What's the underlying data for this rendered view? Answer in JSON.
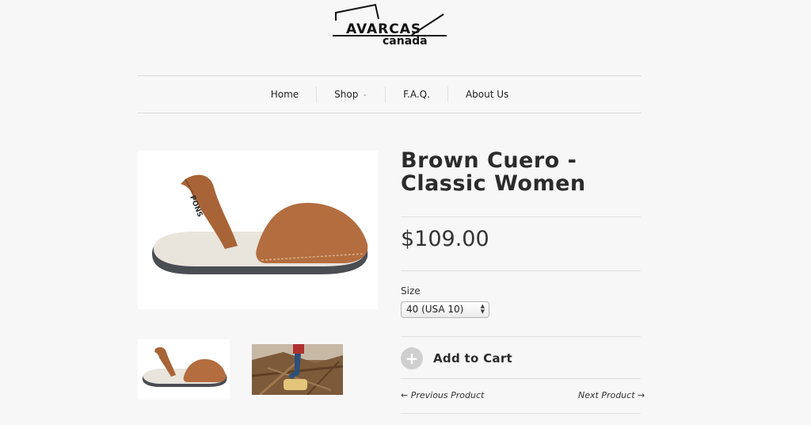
{
  "brand": {
    "logo_main": "AVARCAS",
    "logo_sub": "canada",
    "strap_print": "PONS"
  },
  "nav": {
    "items": [
      {
        "label": "Home"
      },
      {
        "label": "Shop",
        "has_dropdown": true
      },
      {
        "label": "F.A.Q."
      },
      {
        "label": "About Us"
      }
    ]
  },
  "product": {
    "title": "Brown Cuero - Classic Women",
    "price": "$109.00",
    "size_label": "Size",
    "size_selected": "40 (USA 10)",
    "add_to_cart": "Add to Cart",
    "prev_link": "← Previous Product",
    "next_link": "Next Product →"
  },
  "colors": {
    "leather": "#b36d3f",
    "sole": "#4a4d52",
    "footbed": "#e9e4dc"
  }
}
